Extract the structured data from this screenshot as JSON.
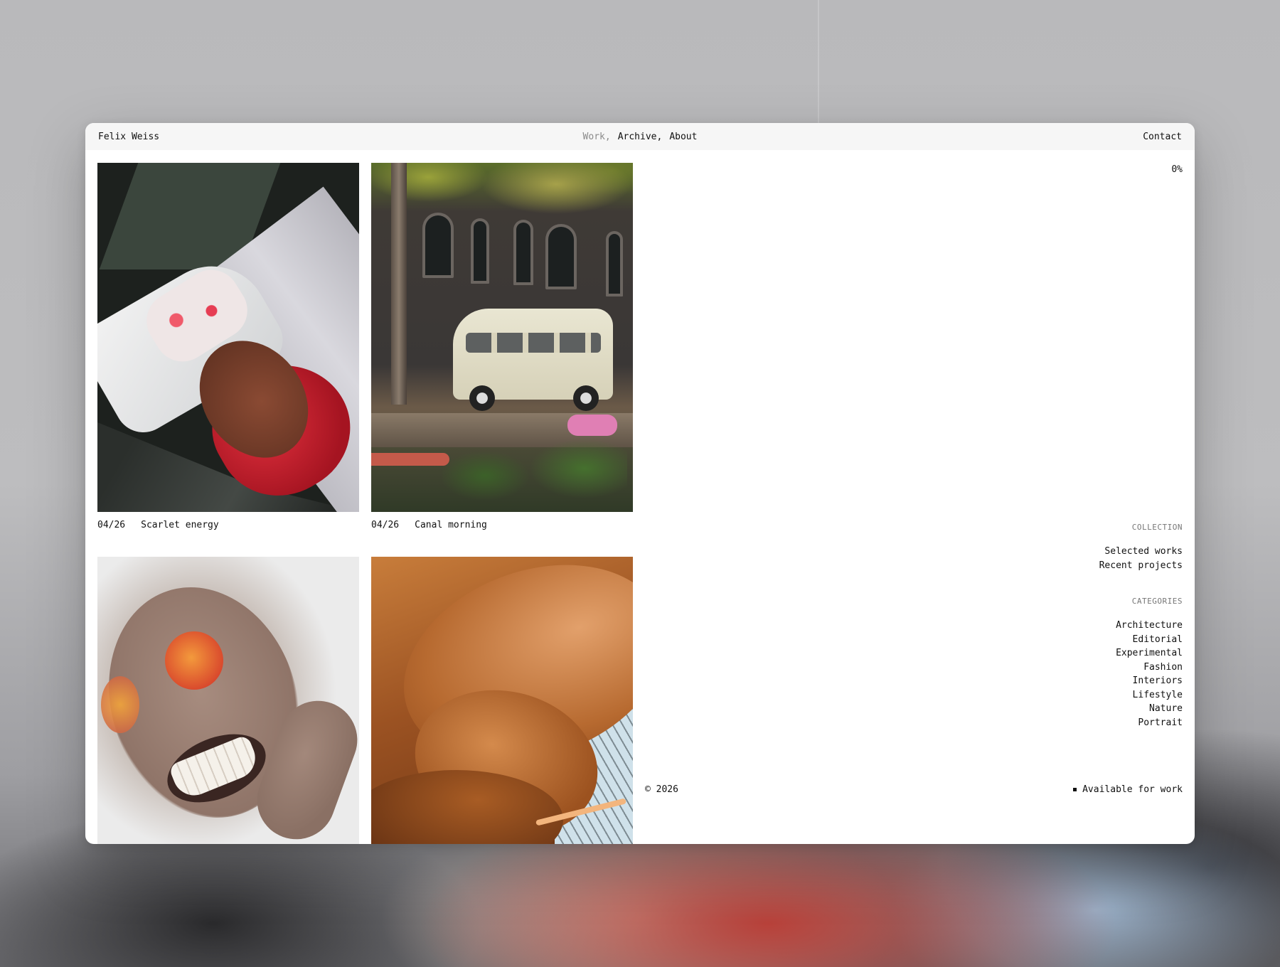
{
  "header": {
    "brand": "Felix Weiss",
    "nav": [
      {
        "label": "Work,",
        "active": true
      },
      {
        "label": "Archive,",
        "active": false
      },
      {
        "label": "About",
        "active": false
      }
    ],
    "contact": "Contact"
  },
  "gallery": [
    {
      "index": "04/26",
      "title": "Scarlet energy",
      "image": "scarlet-energy-photo"
    },
    {
      "index": "04/26",
      "title": "Canal morning",
      "image": "canal-morning-photo"
    },
    {
      "index": "",
      "title": "",
      "image": "grain-portrait-photo"
    },
    {
      "index": "",
      "title": "",
      "image": "wood-staircase-photo"
    }
  ],
  "progress": {
    "label": "0%",
    "value": 0
  },
  "collection": {
    "label": "COLLECTION",
    "items": [
      "Selected works",
      "Recent projects"
    ]
  },
  "categories": {
    "label": "CATEGORIES",
    "items": [
      "Architecture",
      "Editorial",
      "Experimental",
      "Fashion",
      "Interiors",
      "Lifestyle",
      "Nature",
      "Portrait"
    ]
  },
  "footer": {
    "copyright": "© 2026",
    "availability": "Available for work"
  },
  "colors": {
    "accent_muted": "#8a8a8a",
    "text": "#111111",
    "topbar_bg": "#f6f6f6"
  }
}
